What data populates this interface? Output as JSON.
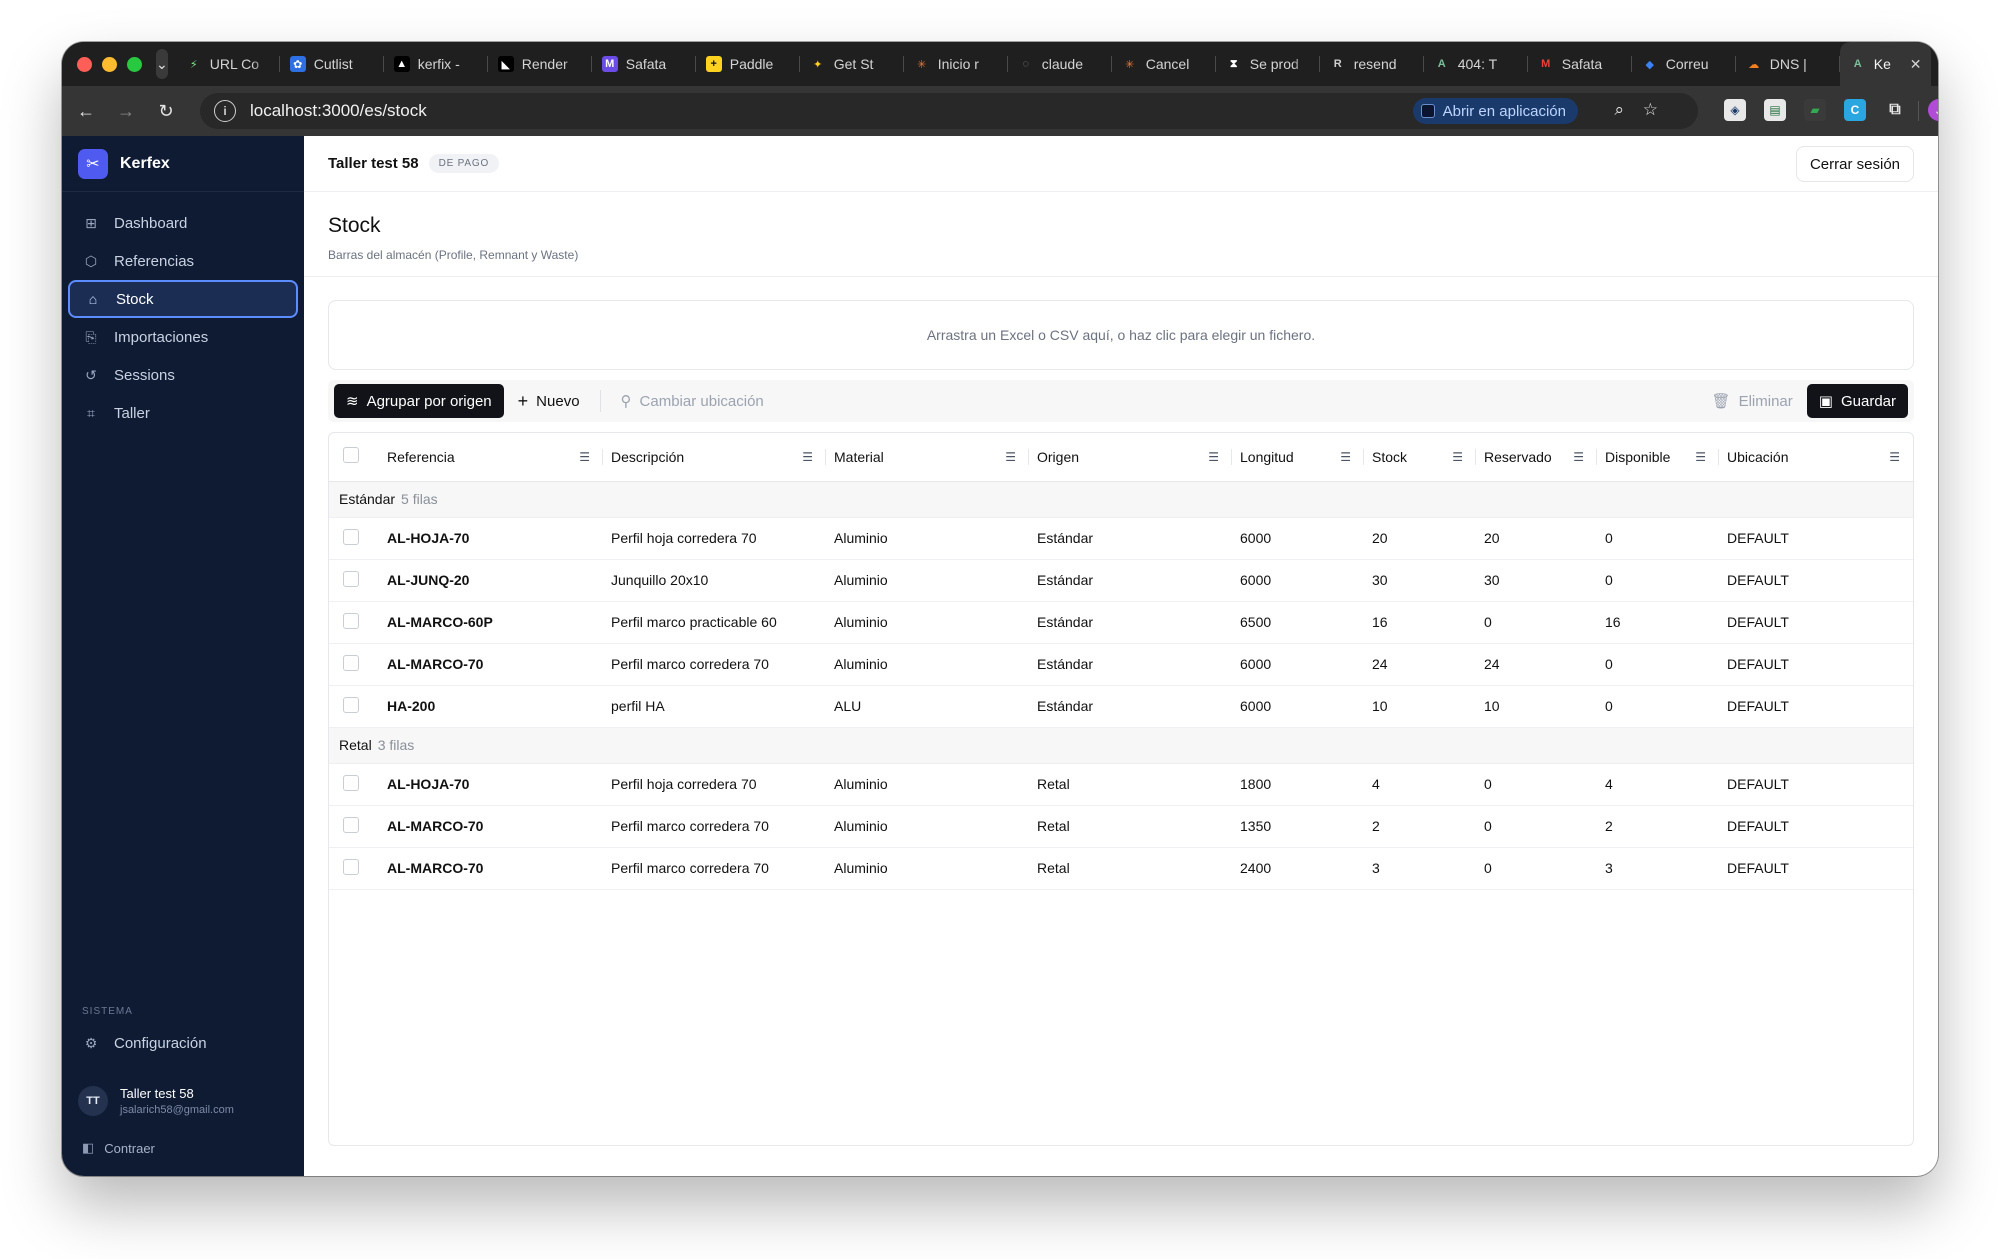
{
  "browser": {
    "tabs": [
      {
        "title": "URL Co",
        "color": "#1f1f1f",
        "glyph": "⚡",
        "glyphColor": "#7ee787"
      },
      {
        "title": "Cutlist",
        "color": "#2f6fe4",
        "glyph": "✿",
        "glyphColor": "#ffffff"
      },
      {
        "title": "kerfix -",
        "color": "#000000",
        "glyph": "▲",
        "glyphColor": "#ffffff"
      },
      {
        "title": "Render",
        "color": "#000000",
        "glyph": "◣",
        "glyphColor": "#ffffff"
      },
      {
        "title": "Safata",
        "color": "#6b4ce6",
        "glyph": "M",
        "glyphColor": "#ffffff"
      },
      {
        "title": "Paddle",
        "color": "#ffd21f",
        "glyph": "+",
        "glyphColor": "#111111"
      },
      {
        "title": "Get St",
        "color": "#1f1f1f",
        "glyph": "✦",
        "glyphColor": "#ffd21f"
      },
      {
        "title": "Inicio r",
        "color": "#1f1f1f",
        "glyph": "✳",
        "glyphColor": "#e07a3f"
      },
      {
        "title": "claude",
        "color": "#1f1f1f",
        "glyph": "◌",
        "glyphColor": "#8a8a8a"
      },
      {
        "title": "Cancel",
        "color": "#1f1f1f",
        "glyph": "✳",
        "glyphColor": "#e07a3f"
      },
      {
        "title": "Se prod",
        "color": "#1f1f1f",
        "glyph": "⧗",
        "glyphColor": "#ffffff"
      },
      {
        "title": "resend",
        "color": "#1f1f1f",
        "glyph": "R",
        "glyphColor": "#cfcfcf"
      },
      {
        "title": "404: T",
        "color": "#1f1f1f",
        "glyph": "A",
        "glyphColor": "#7bbf9b"
      },
      {
        "title": "Safata",
        "color": "#1f1f1f",
        "glyph": "M",
        "glyphColor": "#ea4335"
      },
      {
        "title": "Correu",
        "color": "#1f1f1f",
        "glyph": "◆",
        "glyphColor": "#3b82f6"
      },
      {
        "title": "DNS | ",
        "color": "#1f1f1f",
        "glyph": "☁",
        "glyphColor": "#f38020"
      },
      {
        "title": "Ke",
        "color": "#353535",
        "glyph": "A",
        "glyphColor": "#7bbf9b",
        "active": true
      }
    ],
    "url": "localhost:3000/es/stock",
    "open_app_label": "Abrir en aplicación",
    "profile_initial": "J"
  },
  "sidebar": {
    "brand": "Kerfex",
    "items": [
      {
        "label": "Dashboard",
        "icon": "grid-icon"
      },
      {
        "label": "Referencias",
        "icon": "box-icon"
      },
      {
        "label": "Stock",
        "icon": "warehouse-icon",
        "active": true
      },
      {
        "label": "Importaciones",
        "icon": "file-import-icon"
      },
      {
        "label": "Sessions",
        "icon": "history-icon"
      },
      {
        "label": "Taller",
        "icon": "qr-icon"
      }
    ],
    "section_label": "SISTEMA",
    "config_label": "Configuración",
    "user": {
      "initials": "TT",
      "name": "Taller test 58",
      "email": "jsalarich58@gmail.com"
    },
    "collapse_label": "Contraer"
  },
  "header": {
    "org_name": "Taller test 58",
    "plan_badge": "DE PAGO",
    "logout_label": "Cerrar sesión"
  },
  "page": {
    "title": "Stock",
    "subtitle": "Barras del almacén (Profile, Remnant y Waste)",
    "dropzone_text": "Arrastra un Excel o CSV aquí, o haz clic para elegir un fichero."
  },
  "actions": {
    "group_by": "Agrupar por origen",
    "new": "Nuevo",
    "change_location": "Cambiar ubicación",
    "delete": "Eliminar",
    "save": "Guardar"
  },
  "table": {
    "columns": [
      "Referencia",
      "Descripción",
      "Material",
      "Origen",
      "Longitud",
      "Stock",
      "Reservado",
      "Disponible",
      "Ubicación"
    ],
    "groups": [
      {
        "name": "Estándar",
        "count_label": "5 filas",
        "rows": [
          [
            "AL-HOJA-70",
            "Perfil hoja corredera 70",
            "Aluminio",
            "Estándar",
            "6000",
            "20",
            "20",
            "0",
            "DEFAULT"
          ],
          [
            "AL-JUNQ-20",
            "Junquillo 20x10",
            "Aluminio",
            "Estándar",
            "6000",
            "30",
            "30",
            "0",
            "DEFAULT"
          ],
          [
            "AL-MARCO-60P",
            "Perfil marco practicable 60",
            "Aluminio",
            "Estándar",
            "6500",
            "16",
            "0",
            "16",
            "DEFAULT"
          ],
          [
            "AL-MARCO-70",
            "Perfil marco corredera 70",
            "Aluminio",
            "Estándar",
            "6000",
            "24",
            "24",
            "0",
            "DEFAULT"
          ],
          [
            "HA-200",
            "perfil HA",
            "ALU",
            "Estándar",
            "6000",
            "10",
            "10",
            "0",
            "DEFAULT"
          ]
        ]
      },
      {
        "name": "Retal",
        "count_label": "3 filas",
        "rows": [
          [
            "AL-HOJA-70",
            "Perfil hoja corredera 70",
            "Aluminio",
            "Retal",
            "1800",
            "4",
            "0",
            "4",
            "DEFAULT"
          ],
          [
            "AL-MARCO-70",
            "Perfil marco corredera 70",
            "Aluminio",
            "Retal",
            "1350",
            "2",
            "0",
            "2",
            "DEFAULT"
          ],
          [
            "AL-MARCO-70",
            "Perfil marco corredera 70",
            "Aluminio",
            "Retal",
            "2400",
            "3",
            "0",
            "3",
            "DEFAULT"
          ]
        ]
      }
    ]
  }
}
